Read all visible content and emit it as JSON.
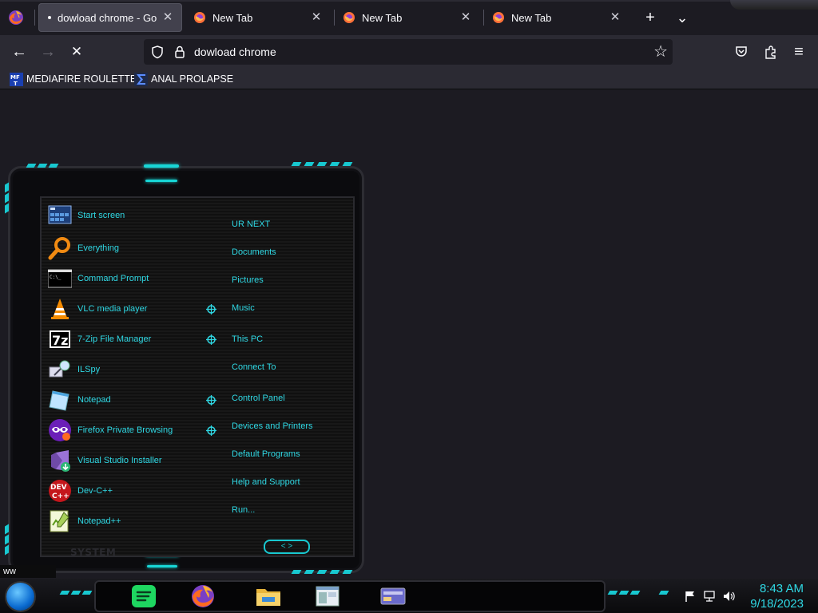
{
  "browser": {
    "tabs": [
      {
        "title": "dowload chrome - Goog",
        "active": true,
        "close": "✕"
      },
      {
        "title": "New Tab",
        "active": false,
        "close": "✕"
      },
      {
        "title": "New Tab",
        "active": false,
        "close": "✕"
      },
      {
        "title": "New Tab",
        "active": false,
        "close": "✕"
      }
    ],
    "new_tab_symbol": "+",
    "tab_list_symbol": "⌄",
    "nav": {
      "back": "←",
      "forward": "→",
      "stop": "✕",
      "url": "dowload chrome",
      "bookmark_star": "☆",
      "menu": "≡"
    },
    "bookmarks": [
      {
        "label": "MEDIAFIRE ROULETTER",
        "icon": "mediafire-icon"
      },
      {
        "label": "ANAL PROLAPSE",
        "icon": "sigma-icon"
      }
    ],
    "status_text": "ww"
  },
  "start_menu": {
    "pinned": [
      {
        "label": "Start screen",
        "icon": "start-screen-icon"
      },
      {
        "label": "Everything",
        "icon": "everything-search-icon"
      },
      {
        "label": "Command Prompt",
        "icon": "command-prompt-icon"
      },
      {
        "label": "VLC media player",
        "icon": "vlc-icon"
      },
      {
        "label": "7-Zip File Manager",
        "icon": "7zip-icon"
      },
      {
        "label": "ILSpy",
        "icon": "ilspy-icon"
      },
      {
        "label": "Notepad",
        "icon": "notepad-icon"
      },
      {
        "label": "Firefox Private Browsing",
        "icon": "firefox-private-icon"
      },
      {
        "label": "Visual Studio Installer",
        "icon": "visual-studio-installer-icon"
      },
      {
        "label": "Dev-C++",
        "icon": "devcpp-icon"
      },
      {
        "label": "Notepad++",
        "icon": "notepadpp-icon"
      }
    ],
    "places": [
      {
        "label": "UR NEXT",
        "has_arrow": false
      },
      {
        "label": "Documents",
        "has_arrow": false
      },
      {
        "label": "Pictures",
        "has_arrow": false
      },
      {
        "label": "Music",
        "has_arrow": true
      },
      {
        "label": "This PC",
        "has_arrow": true
      },
      {
        "label": "Connect To",
        "has_arrow": false
      },
      {
        "label": "Control Panel",
        "has_arrow": true
      },
      {
        "label": "Devices and Printers",
        "has_arrow": true
      },
      {
        "label": "Default Programs",
        "has_arrow": false
      },
      {
        "label": "Help and Support",
        "has_arrow": false
      },
      {
        "label": "Run...",
        "has_arrow": false
      }
    ],
    "system_label": "SYSTEM",
    "nav_arrows": "< >"
  },
  "taskbar": {
    "pinned_apps": [
      "spotify-icon",
      "firefox-icon",
      "file-explorer-icon",
      "window-app-icon",
      "card-app-icon"
    ],
    "tray": [
      "flag-icon",
      "network-icon",
      "volume-icon"
    ],
    "time": "8:43 AM",
    "date": "9/18/2023"
  },
  "colors": {
    "accent_cyan": "#2fd8e4",
    "chrome_bg": "#1c1b22",
    "toolbar_bg": "#2b2a33"
  }
}
